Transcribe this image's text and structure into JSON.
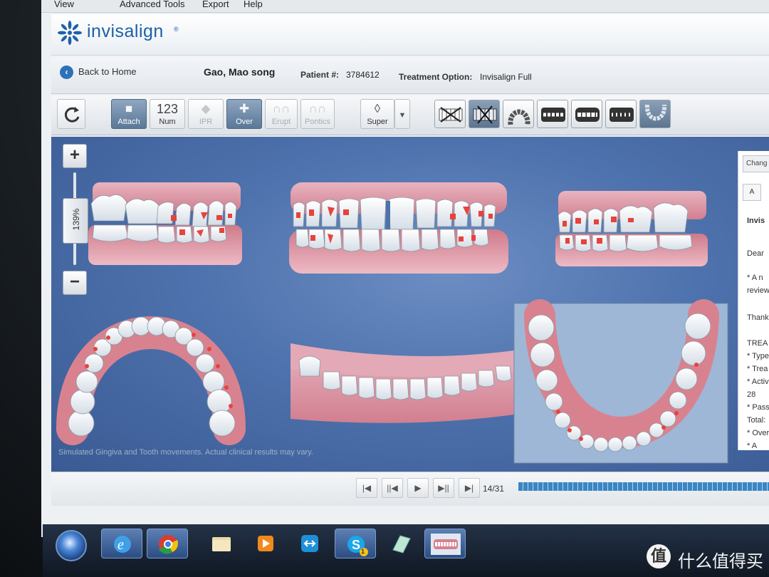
{
  "menu": {
    "items": [
      "View",
      "Advanced Tools",
      "Export",
      "Help"
    ]
  },
  "header": {
    "logo_text": "invisalign",
    "logo_mark": "®"
  },
  "patient_bar": {
    "back_label": "Back to Home",
    "patient_name": "Gao, Mao song",
    "patient_num_label": "Patient #:",
    "patient_num": "3784612",
    "treatment_label": "Treatment Option:",
    "treatment_value": "Invisalign Full"
  },
  "toolbar": {
    "tools": [
      {
        "label": "Attach",
        "glyph": "lock-icon",
        "state": "active"
      },
      {
        "label": "Num",
        "glyph_text": "123",
        "state": "normal"
      },
      {
        "label": "IPR",
        "glyph": "diamond-icon",
        "state": "disabled"
      },
      {
        "label": "Over",
        "glyph": "crosshair-icon",
        "state": "active"
      },
      {
        "label": "Erupt",
        "glyph": "erupt-teeth-icon",
        "state": "disabled"
      },
      {
        "label": "Pontics",
        "glyph": "pontics-teeth-icon",
        "state": "disabled"
      }
    ],
    "superimpose_label": "Super",
    "view_buttons": [
      "remove-attachments-view",
      "hide-attachments-view",
      "upper-arch-view",
      "right-buccal-view",
      "front-view",
      "left-buccal-view",
      "lower-arch-view"
    ]
  },
  "viewport": {
    "zoom_value": "139%",
    "zoom_in": "+",
    "zoom_out": "−",
    "disclaimer": "Simulated Gingiva and Tooth movements.  Actual clinical results may vary."
  },
  "side_panel": {
    "tab_label": "Chang",
    "button_label": "A",
    "lines": [
      "Invis",
      "Dear",
      "* A n",
      "review",
      "Thank",
      "TREA",
      "* Type",
      "* Trea",
      "* Activ",
      "28",
      "* Pass",
      "Total:",
      "* Over",
      "* A"
    ]
  },
  "playback": {
    "stage_text": "14/31",
    "current_stage": "14",
    "total_stages": 31,
    "buttons": [
      "first-stage",
      "previous-stage",
      "play",
      "next-stage",
      "last-stage"
    ]
  },
  "taskbar": {
    "apps": [
      "internet-explorer",
      "chrome",
      "file-explorer",
      "media-player",
      "teamviewer",
      "skype",
      "notepad",
      "invisalign-clincheck"
    ],
    "skype_badge": "1"
  },
  "colors": {
    "accent": "#1f5fa8",
    "viewport_bg": "#5273ad",
    "attachment_red": "#e8423c",
    "gum_pink": "#d9828f",
    "timeline": "#3a86c4"
  },
  "watermark": {
    "icon": "值",
    "text": "什么值得买"
  }
}
